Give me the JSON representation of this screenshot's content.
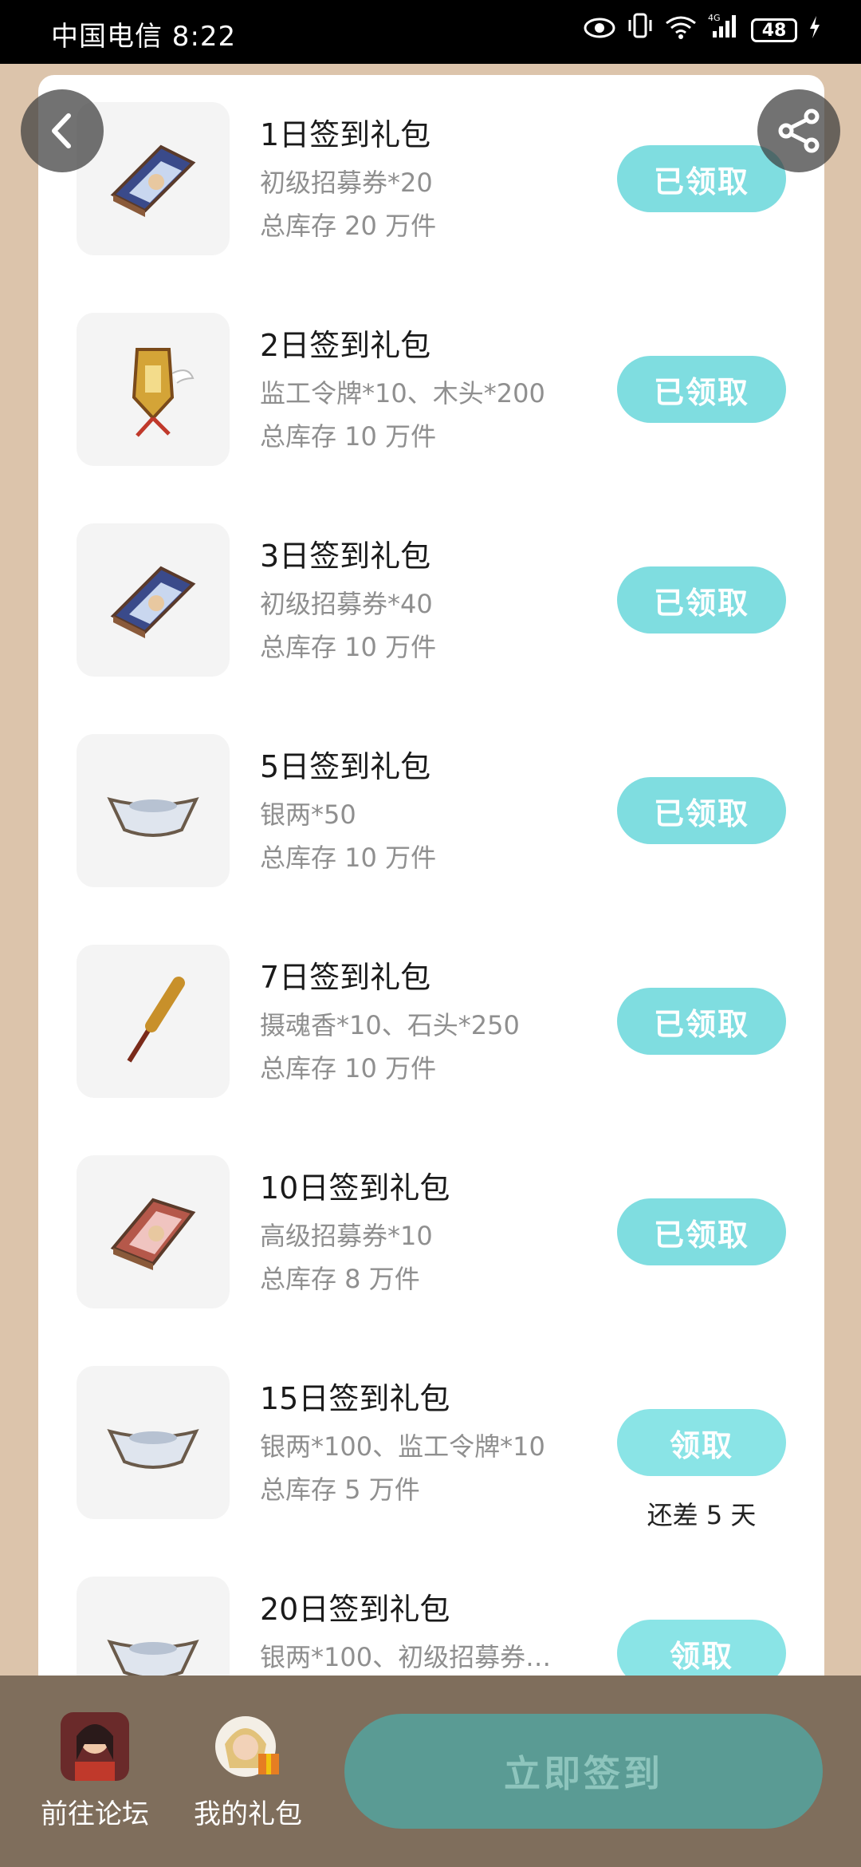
{
  "status_bar": {
    "carrier_time": "中国电信 8:22",
    "network": "4G",
    "battery": "48"
  },
  "items": [
    {
      "title": "1日签到礼包",
      "desc": "初级招募券*20",
      "stock": "总库存 20 万件",
      "button": "已领取",
      "icon": "book-icon"
    },
    {
      "title": "2日签到礼包",
      "desc": "监工令牌*10、木头*200",
      "stock": "总库存 10 万件",
      "button": "已领取",
      "icon": "token-icon"
    },
    {
      "title": "3日签到礼包",
      "desc": "初级招募券*40",
      "stock": "总库存 10 万件",
      "button": "已领取",
      "icon": "book-icon"
    },
    {
      "title": "5日签到礼包",
      "desc": "银两*50",
      "stock": "总库存 10 万件",
      "button": "已领取",
      "icon": "silver-ingot-icon"
    },
    {
      "title": "7日签到礼包",
      "desc": "摄魂香*10、石头*250",
      "stock": "总库存 10 万件",
      "button": "已领取",
      "icon": "incense-icon"
    },
    {
      "title": "10日签到礼包",
      "desc": "高级招募券*10",
      "stock": "总库存 8 万件",
      "button": "已领取",
      "icon": "red-book-icon"
    },
    {
      "title": "15日签到礼包",
      "desc": "银两*100、监工令牌*10",
      "stock": "总库存 5 万件",
      "button": "领取",
      "remain": "还差 5 天",
      "icon": "silver-ingot-icon"
    },
    {
      "title": "20日签到礼包",
      "desc": "银两*100、初级招募券…",
      "stock": "",
      "button": "领取",
      "icon": "silver-ingot-icon"
    }
  ],
  "bottom": {
    "forum_label": "前往论坛",
    "gifts_label": "我的礼包",
    "signin_label": "立即签到"
  }
}
